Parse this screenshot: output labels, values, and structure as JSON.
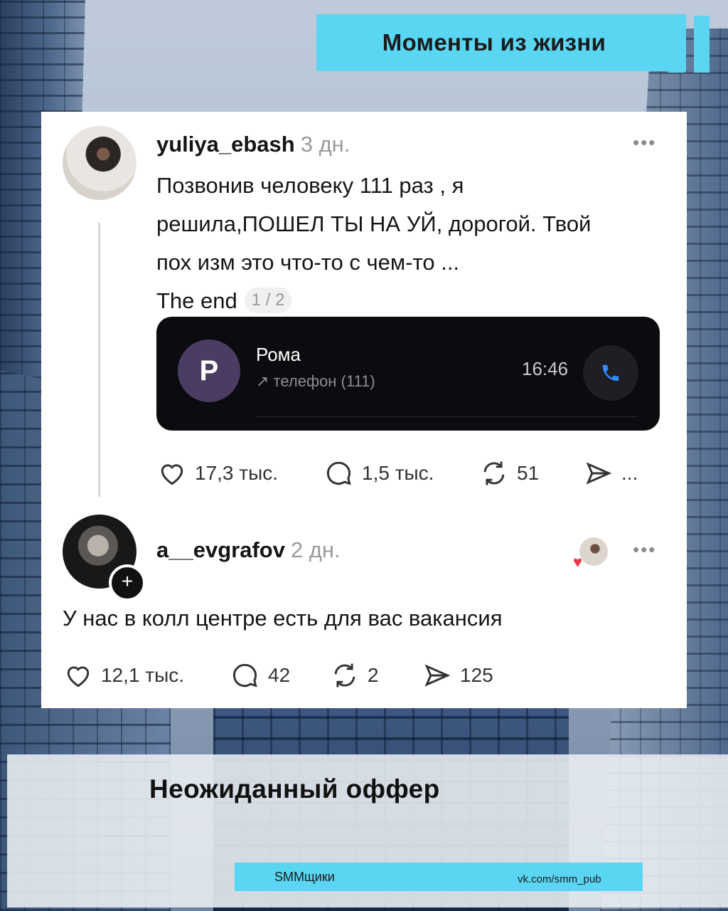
{
  "header": {
    "title": "Моменты из жизни"
  },
  "post": {
    "username": "yuliya_ebash",
    "time": "3 дн.",
    "text_lines": [
      "Позвонив человеку 111 раз , я",
      "решила,ПОШЕЛ ТЫ НА УЙ, дорогой. Твой",
      "пох изм это что-то с чем-то ...",
      "The end"
    ],
    "pager": "1 / 2",
    "call": {
      "avatar_letter": "Р",
      "name": "Рома",
      "subtitle": "↗ телефон (111)",
      "time": "16:46"
    },
    "likes": "17,3 тыс.",
    "comments": "1,5 тыс.",
    "reposts": "51",
    "shares": "..."
  },
  "reply": {
    "username": "a__evgrafov",
    "time": "2 дн.",
    "text": "У нас в колл центре есть для вас вакансия",
    "likes": "12,1 тыс.",
    "comments": "42",
    "reposts": "2",
    "shares": "125"
  },
  "more_label": "•••",
  "add_label": "+",
  "bottom": {
    "title": "Неожиданный оффер"
  },
  "footer": {
    "left": "SMMщики",
    "right": "vk.com/smm_pub"
  },
  "colors": {
    "accent": "#5ad5f2",
    "call_bg": "#0c0b0f",
    "call_icon": "#2f8cff"
  }
}
